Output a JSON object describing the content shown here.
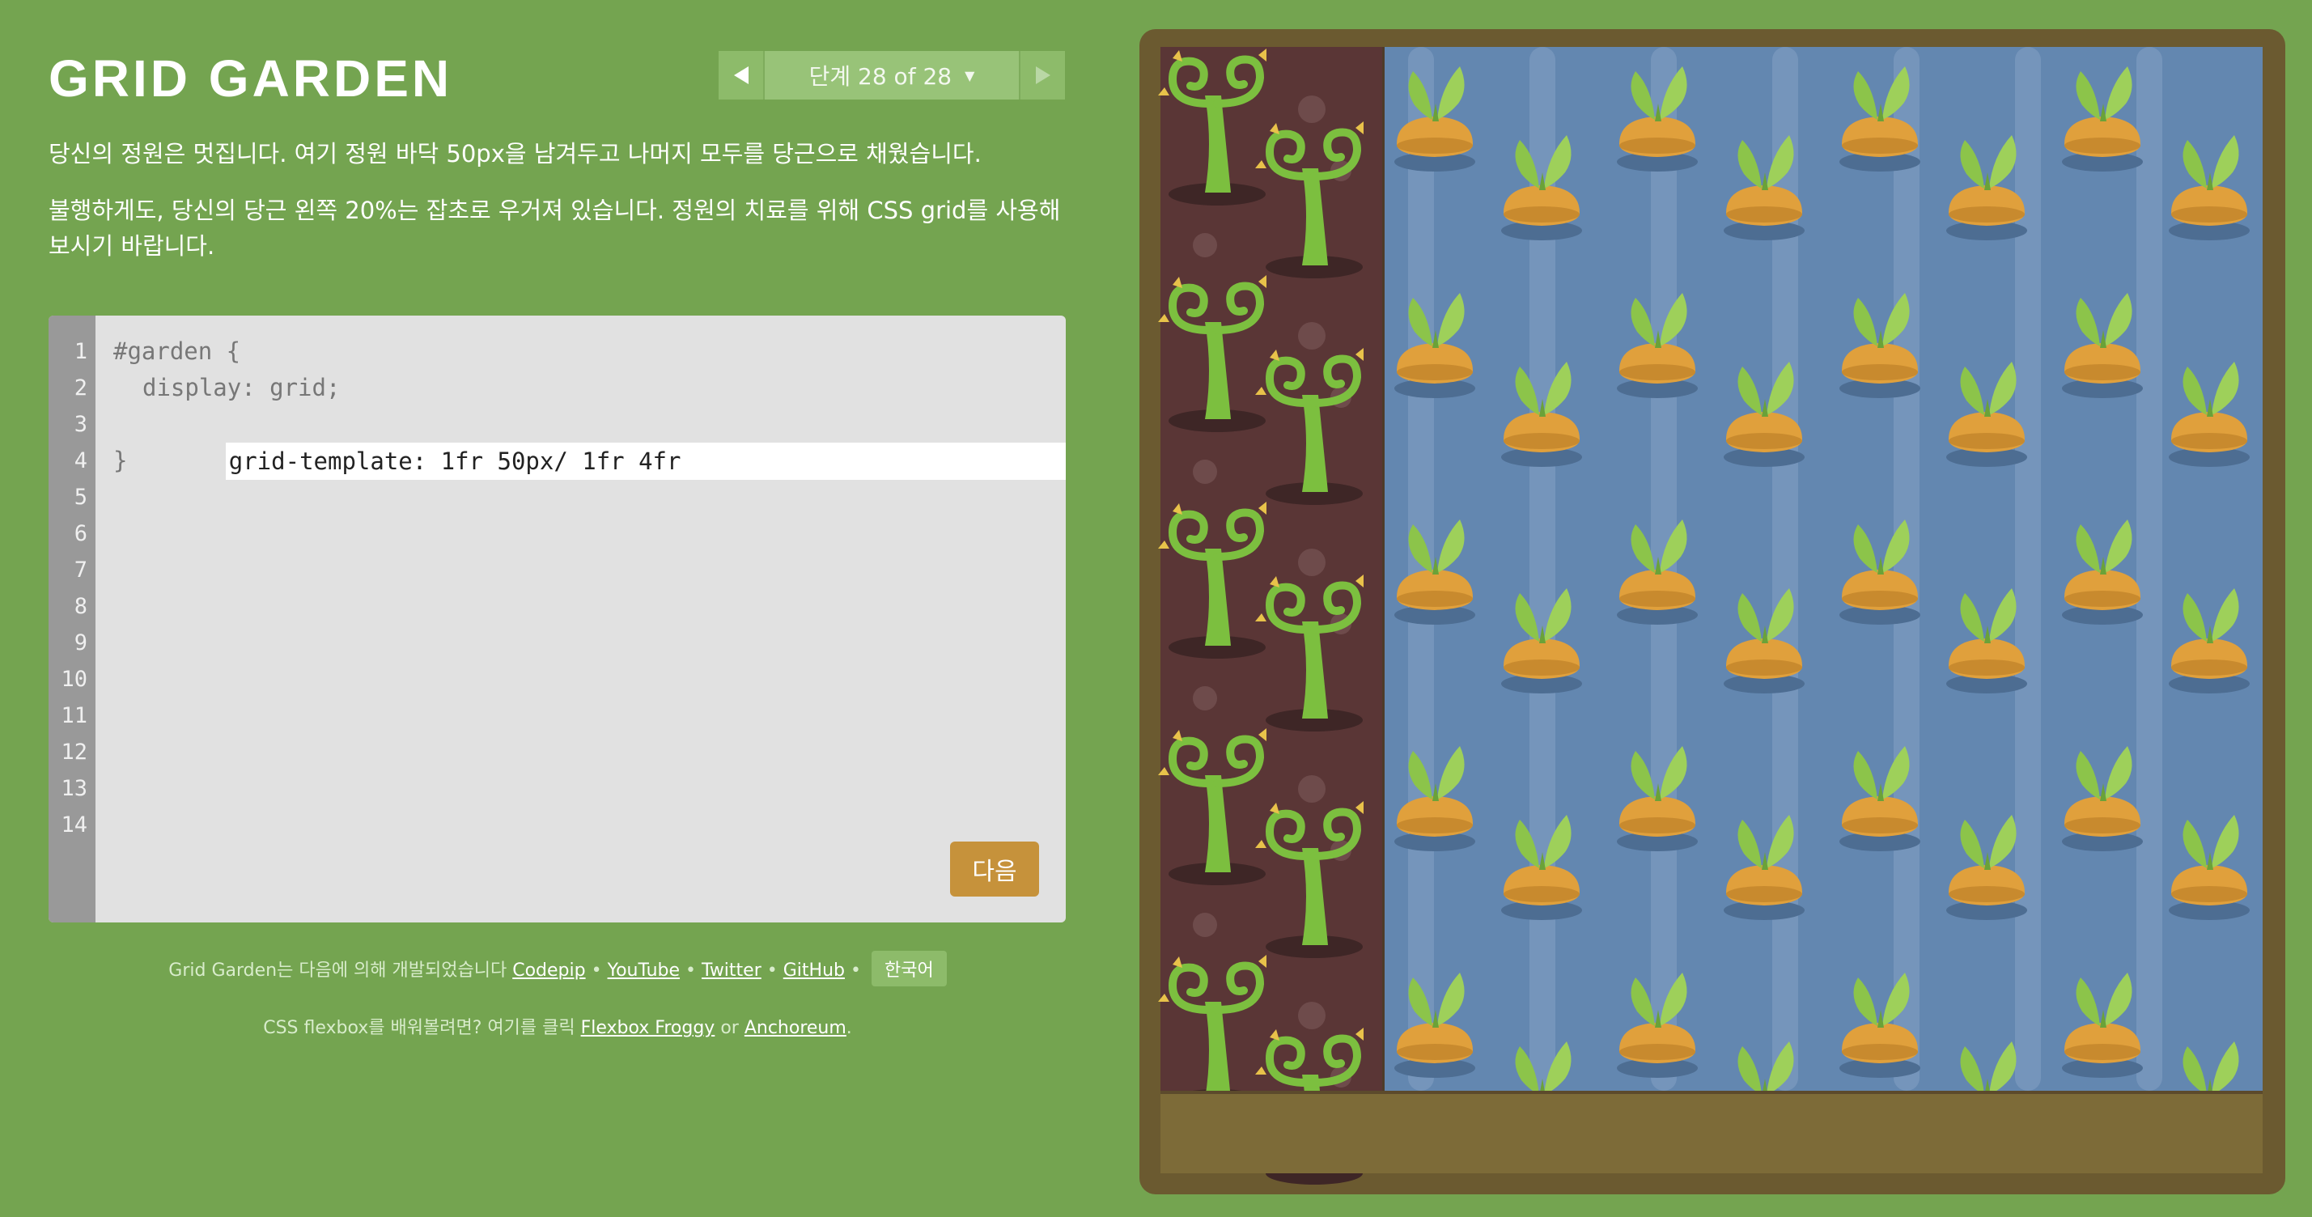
{
  "header": {
    "title": "GRID GARDEN",
    "level_label": "단계 28 of 28",
    "prev_icon": "triangle-left",
    "next_icon": "triangle-right"
  },
  "instructions": {
    "p1": "당신의 정원은 멋집니다. 여기 정원 바닥 50px을 남겨두고 나머지 모두를 당근으로 채웠습니다.",
    "p2": "불행하게도, 당신의 당근 왼쪽 20%는 잡초로 우거져 있습니다. 정원의 치료를 위해 CSS grid를 사용해 보시기 바랍니다."
  },
  "editor": {
    "line_numbers": [
      "1",
      "2",
      "3",
      "4",
      "5",
      "6",
      "7",
      "8",
      "9",
      "10",
      "11",
      "12",
      "13",
      "14"
    ],
    "line1": "#garden {",
    "line2": "display: grid;",
    "input_value": "grid-template: 1fr 50px/ 1fr 4fr",
    "line4": "}",
    "next_button": "다음"
  },
  "credits": {
    "prefix": "Grid Garden는 다음에 의해 개발되었습니다",
    "codepip": "Codepip",
    "youtube": "YouTube",
    "twitter": "Twitter",
    "github": "GitHub",
    "sep": "•",
    "language": "한국어"
  },
  "promo": {
    "prefix": "CSS flexbox를 배워볼려면? 여기를 클릭",
    "froggy": "Flexbox Froggy",
    "or": "or",
    "anchoreum": "Anchoreum",
    "suffix": "."
  },
  "colors": {
    "background": "#74a450",
    "weeds": "#5a3636",
    "water": "#6387b0",
    "soil": "#7d6b38",
    "next_button": "#c6923b"
  }
}
